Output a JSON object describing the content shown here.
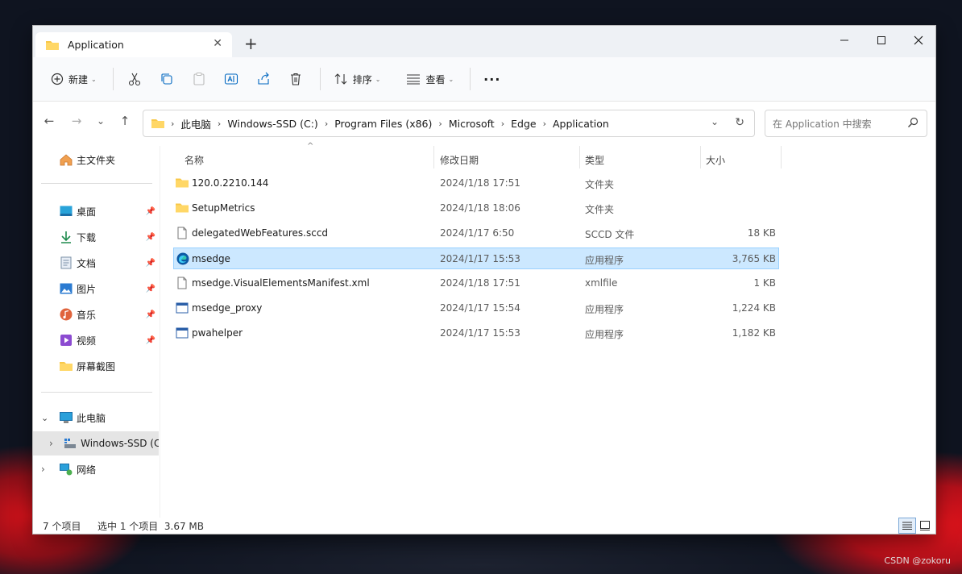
{
  "window": {
    "tab_title": "Application",
    "new_tab_symbol": "+",
    "close_tab_symbol": "✕"
  },
  "toolbar": {
    "new_label": "新建",
    "sort_label": "排序",
    "view_label": "查看",
    "more_label": "···",
    "icons": [
      "add-circle-icon",
      "cut-icon",
      "copy-icon",
      "paste-icon",
      "rename-icon",
      "share-icon",
      "delete-icon",
      "sort-icon",
      "view-icon",
      "more-icon"
    ]
  },
  "address": {
    "crumbs": [
      "此电脑",
      "Windows-SSD (C:)",
      "Program Files (x86)",
      "Microsoft",
      "Edge",
      "Application"
    ],
    "search_placeholder": "在 Application 中搜索"
  },
  "sidebar": {
    "home": "主文件夹",
    "quick": [
      {
        "label": "桌面",
        "icon": "desktop-icon",
        "pinned": true
      },
      {
        "label": "下载",
        "icon": "download-icon",
        "pinned": true
      },
      {
        "label": "文档",
        "icon": "document-icon",
        "pinned": true
      },
      {
        "label": "图片",
        "icon": "pictures-icon",
        "pinned": true
      },
      {
        "label": "音乐",
        "icon": "music-icon",
        "pinned": true
      },
      {
        "label": "视频",
        "icon": "video-icon",
        "pinned": true
      },
      {
        "label": "屏幕截图",
        "icon": "folder-icon",
        "pinned": false
      }
    ],
    "this_pc": "此电脑",
    "drive": "Windows-SSD (C",
    "network": "网络"
  },
  "columns": {
    "name": "名称",
    "date": "修改日期",
    "type": "类型",
    "size": "大小"
  },
  "files": [
    {
      "name": "120.0.2210.144",
      "date": "2024/1/18 17:51",
      "type": "文件夹",
      "size": "",
      "icon": "folder",
      "selected": false
    },
    {
      "name": "SetupMetrics",
      "date": "2024/1/18 18:06",
      "type": "文件夹",
      "size": "",
      "icon": "folder",
      "selected": false
    },
    {
      "name": "delegatedWebFeatures.sccd",
      "date": "2024/1/17 6:50",
      "type": "SCCD 文件",
      "size": "18 KB",
      "icon": "file",
      "selected": false
    },
    {
      "name": "msedge",
      "date": "2024/1/17 15:53",
      "type": "应用程序",
      "size": "3,765 KB",
      "icon": "edge",
      "selected": true
    },
    {
      "name": "msedge.VisualElementsManifest.xml",
      "date": "2024/1/18 17:51",
      "type": "xmlfile",
      "size": "1 KB",
      "icon": "file",
      "selected": false
    },
    {
      "name": "msedge_proxy",
      "date": "2024/1/17 15:54",
      "type": "应用程序",
      "size": "1,224 KB",
      "icon": "app",
      "selected": false
    },
    {
      "name": "pwahelper",
      "date": "2024/1/17 15:53",
      "type": "应用程序",
      "size": "1,182 KB",
      "icon": "app",
      "selected": false
    }
  ],
  "status": {
    "count": "7 个项目",
    "selection": "选中 1 个项目  3.67 MB"
  },
  "watermark": "CSDN @zokoru",
  "colors": {
    "selection_bg": "#cce8ff",
    "selection_border": "#99d1ff",
    "folder": "#f8c849",
    "accent": "#0067c0"
  }
}
